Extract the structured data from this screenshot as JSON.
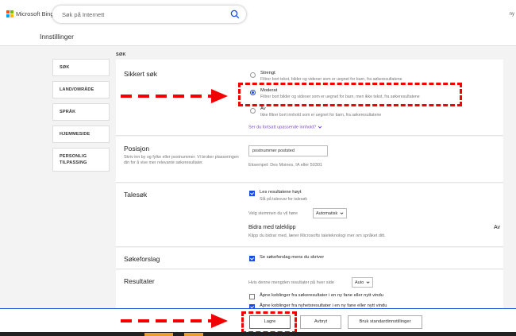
{
  "colors": {
    "accent": "#174ae4",
    "link": "#7e4ad3",
    "annotation": "#f20000"
  },
  "header": {
    "brand": "Microsoft Bing",
    "search_placeholder": "Søk på Internett",
    "user_text": "ny"
  },
  "page_title": "Innstillinger",
  "section_label": "SØK",
  "nav": [
    {
      "label": "SØK"
    },
    {
      "label": "LAND/OMRÅDE"
    },
    {
      "label": "SPRÅK"
    },
    {
      "label": "HJEMMESIDE"
    },
    {
      "label_line1": "PERSONLIG",
      "label_line2": "TILPASSING"
    }
  ],
  "safe_search": {
    "title": "Sikkert søk",
    "options": [
      {
        "label": "Strengt",
        "desc": "Filtrer bort tekst, bilder og videoer som er uegnet for barn, fra søkeresultatene",
        "selected": false
      },
      {
        "label": "Moderat",
        "desc": "Filtrer bort bilder og videoer som er uegnet for barn, men ikke tekst, fra søkeresultatene",
        "selected": true
      },
      {
        "label": "Av",
        "desc": "Ikke filtrer bort innhold som er uegnet for barn, fra søkeresultatene",
        "selected": false
      }
    ],
    "link": "Ser du fortsatt upassende innhold?"
  },
  "position": {
    "title": "Posisjon",
    "desc": "Skriv inn by og fylke eller postnummer. Vi bruker plasseringen din for å vise mer relevante søkeresultater.",
    "input_value": "postnummer poststed",
    "example": "Eksempel: Des Moines, IA eller 50301"
  },
  "voice": {
    "title": "Talesøk",
    "read_aloud_label": "Les resultatene høyt",
    "read_aloud_desc": "Slå på talesvar for talesøk",
    "read_aloud_checked": true,
    "voice_label": "Velg stemmen du vil høre",
    "voice_value": "Automatisk",
    "contribute_title": "Bidra med taleklipp",
    "contribute_desc": "Klipp du bidrar med, lærer Microsofts taleteknologi mer om språket ditt.",
    "contribute_state": "Av"
  },
  "suggestions": {
    "title": "Søkeforslag",
    "label": "Se søkeforslag mens du skriver",
    "checked": true
  },
  "results": {
    "title": "Resultater",
    "per_page_label": "Hvis denne mengden resultater på hver side",
    "per_page_value": "Auto",
    "open_links_label": "Åpne koblinger fra søkeresultater i en ny fane eller nytt vindu",
    "open_links_checked": false,
    "news_links_label": "Åpne koblinger fra nyhetsresultater i en ny fane eller nytt vindu",
    "news_links_checked": true
  },
  "footer": {
    "save": "Lagre",
    "cancel": "Avbryt",
    "defaults": "Bruk standardinnstillinger"
  }
}
